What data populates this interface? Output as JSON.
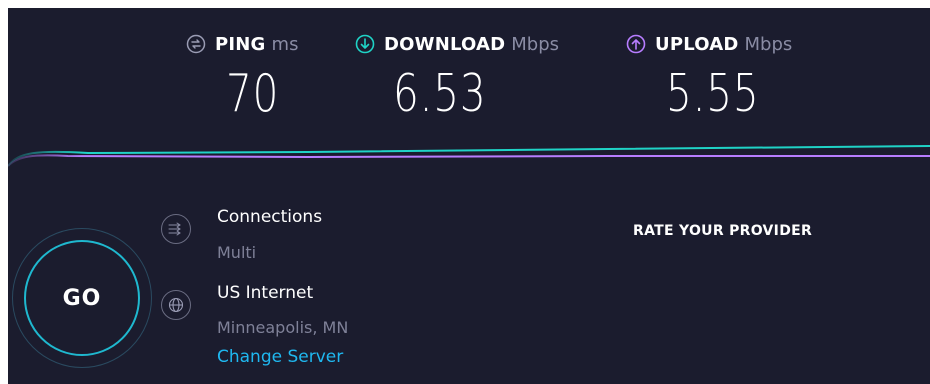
{
  "metrics": {
    "ping": {
      "label": "PING",
      "unit": "ms",
      "value": "70",
      "icon": "ping-icon",
      "color": "#9a9cb4"
    },
    "download": {
      "label": "DOWNLOAD",
      "unit": "Mbps",
      "value": "6.53",
      "icon": "download-arrow-icon",
      "color": "#1fd3c6"
    },
    "upload": {
      "label": "UPLOAD",
      "unit": "Mbps",
      "value": "5.55",
      "icon": "upload-arrow-icon",
      "color": "#b77dff"
    }
  },
  "graph": {
    "download_color": "#1fd3c6",
    "upload_color": "#b77dff"
  },
  "go": {
    "label": "GO",
    "color": "#1fb8cf"
  },
  "connections": {
    "title": "Connections",
    "value": "Multi",
    "icon": "connections-icon"
  },
  "server": {
    "provider": "US Internet",
    "location": "Minneapolis, MN",
    "change_label": "Change Server",
    "icon": "globe-icon"
  },
  "rate_provider": {
    "label": "RATE YOUR PROVIDER"
  },
  "colors": {
    "background": "#1b1c2e",
    "link": "#1fb8f0"
  }
}
